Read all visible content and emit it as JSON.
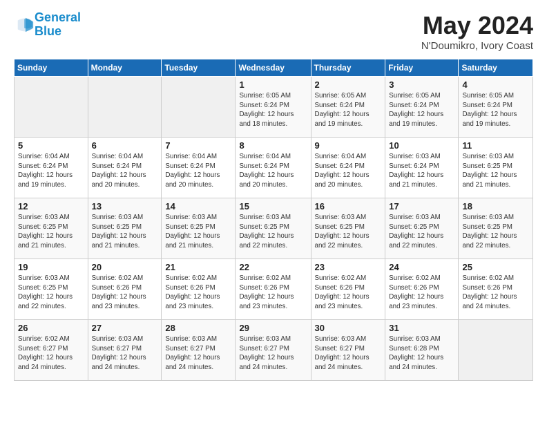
{
  "header": {
    "logo_line1": "General",
    "logo_line2": "Blue",
    "month": "May 2024",
    "location": "N'Doumikro, Ivory Coast"
  },
  "weekdays": [
    "Sunday",
    "Monday",
    "Tuesday",
    "Wednesday",
    "Thursday",
    "Friday",
    "Saturday"
  ],
  "weeks": [
    [
      {
        "day": "",
        "info": ""
      },
      {
        "day": "",
        "info": ""
      },
      {
        "day": "",
        "info": ""
      },
      {
        "day": "1",
        "info": "Sunrise: 6:05 AM\nSunset: 6:24 PM\nDaylight: 12 hours\nand 18 minutes."
      },
      {
        "day": "2",
        "info": "Sunrise: 6:05 AM\nSunset: 6:24 PM\nDaylight: 12 hours\nand 19 minutes."
      },
      {
        "day": "3",
        "info": "Sunrise: 6:05 AM\nSunset: 6:24 PM\nDaylight: 12 hours\nand 19 minutes."
      },
      {
        "day": "4",
        "info": "Sunrise: 6:05 AM\nSunset: 6:24 PM\nDaylight: 12 hours\nand 19 minutes."
      }
    ],
    [
      {
        "day": "5",
        "info": "Sunrise: 6:04 AM\nSunset: 6:24 PM\nDaylight: 12 hours\nand 19 minutes."
      },
      {
        "day": "6",
        "info": "Sunrise: 6:04 AM\nSunset: 6:24 PM\nDaylight: 12 hours\nand 20 minutes."
      },
      {
        "day": "7",
        "info": "Sunrise: 6:04 AM\nSunset: 6:24 PM\nDaylight: 12 hours\nand 20 minutes."
      },
      {
        "day": "8",
        "info": "Sunrise: 6:04 AM\nSunset: 6:24 PM\nDaylight: 12 hours\nand 20 minutes."
      },
      {
        "day": "9",
        "info": "Sunrise: 6:04 AM\nSunset: 6:24 PM\nDaylight: 12 hours\nand 20 minutes."
      },
      {
        "day": "10",
        "info": "Sunrise: 6:03 AM\nSunset: 6:24 PM\nDaylight: 12 hours\nand 21 minutes."
      },
      {
        "day": "11",
        "info": "Sunrise: 6:03 AM\nSunset: 6:25 PM\nDaylight: 12 hours\nand 21 minutes."
      }
    ],
    [
      {
        "day": "12",
        "info": "Sunrise: 6:03 AM\nSunset: 6:25 PM\nDaylight: 12 hours\nand 21 minutes."
      },
      {
        "day": "13",
        "info": "Sunrise: 6:03 AM\nSunset: 6:25 PM\nDaylight: 12 hours\nand 21 minutes."
      },
      {
        "day": "14",
        "info": "Sunrise: 6:03 AM\nSunset: 6:25 PM\nDaylight: 12 hours\nand 21 minutes."
      },
      {
        "day": "15",
        "info": "Sunrise: 6:03 AM\nSunset: 6:25 PM\nDaylight: 12 hours\nand 22 minutes."
      },
      {
        "day": "16",
        "info": "Sunrise: 6:03 AM\nSunset: 6:25 PM\nDaylight: 12 hours\nand 22 minutes."
      },
      {
        "day": "17",
        "info": "Sunrise: 6:03 AM\nSunset: 6:25 PM\nDaylight: 12 hours\nand 22 minutes."
      },
      {
        "day": "18",
        "info": "Sunrise: 6:03 AM\nSunset: 6:25 PM\nDaylight: 12 hours\nand 22 minutes."
      }
    ],
    [
      {
        "day": "19",
        "info": "Sunrise: 6:03 AM\nSunset: 6:25 PM\nDaylight: 12 hours\nand 22 minutes."
      },
      {
        "day": "20",
        "info": "Sunrise: 6:02 AM\nSunset: 6:26 PM\nDaylight: 12 hours\nand 23 minutes."
      },
      {
        "day": "21",
        "info": "Sunrise: 6:02 AM\nSunset: 6:26 PM\nDaylight: 12 hours\nand 23 minutes."
      },
      {
        "day": "22",
        "info": "Sunrise: 6:02 AM\nSunset: 6:26 PM\nDaylight: 12 hours\nand 23 minutes."
      },
      {
        "day": "23",
        "info": "Sunrise: 6:02 AM\nSunset: 6:26 PM\nDaylight: 12 hours\nand 23 minutes."
      },
      {
        "day": "24",
        "info": "Sunrise: 6:02 AM\nSunset: 6:26 PM\nDaylight: 12 hours\nand 23 minutes."
      },
      {
        "day": "25",
        "info": "Sunrise: 6:02 AM\nSunset: 6:26 PM\nDaylight: 12 hours\nand 24 minutes."
      }
    ],
    [
      {
        "day": "26",
        "info": "Sunrise: 6:02 AM\nSunset: 6:27 PM\nDaylight: 12 hours\nand 24 minutes."
      },
      {
        "day": "27",
        "info": "Sunrise: 6:03 AM\nSunset: 6:27 PM\nDaylight: 12 hours\nand 24 minutes."
      },
      {
        "day": "28",
        "info": "Sunrise: 6:03 AM\nSunset: 6:27 PM\nDaylight: 12 hours\nand 24 minutes."
      },
      {
        "day": "29",
        "info": "Sunrise: 6:03 AM\nSunset: 6:27 PM\nDaylight: 12 hours\nand 24 minutes."
      },
      {
        "day": "30",
        "info": "Sunrise: 6:03 AM\nSunset: 6:27 PM\nDaylight: 12 hours\nand 24 minutes."
      },
      {
        "day": "31",
        "info": "Sunrise: 6:03 AM\nSunset: 6:28 PM\nDaylight: 12 hours\nand 24 minutes."
      },
      {
        "day": "",
        "info": ""
      }
    ]
  ]
}
